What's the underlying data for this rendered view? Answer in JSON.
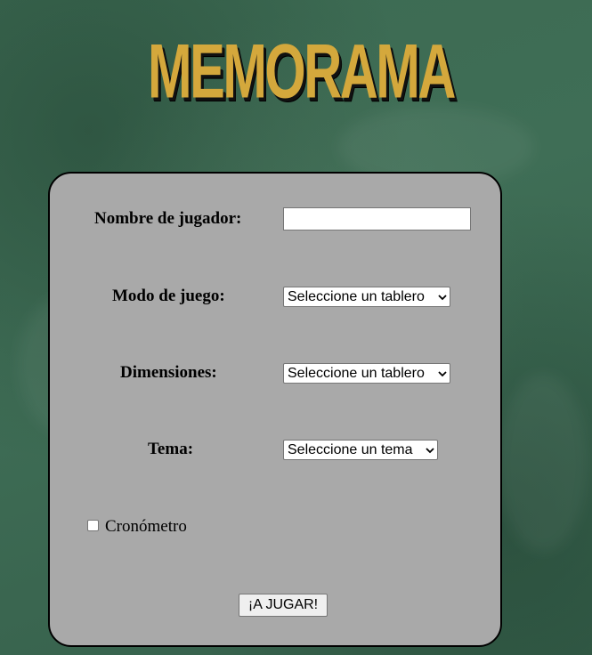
{
  "app": {
    "title": "MEMORAMA"
  },
  "form": {
    "player_name": {
      "label": "Nombre de jugador:",
      "value": ""
    },
    "game_mode": {
      "label": "Modo de juego:",
      "selected": "Seleccione un tablero"
    },
    "dimensions": {
      "label": "Dimensiones:",
      "selected": "Seleccione un tablero"
    },
    "theme": {
      "label": "Tema:",
      "selected": "Seleccione un tema"
    },
    "timer": {
      "label": "Cronómetro",
      "checked": false
    },
    "play_button": {
      "label": "¡A JUGAR!"
    }
  },
  "colors": {
    "background": "#3f6e56",
    "title": "#d4a83c",
    "panel": "#a9a9a9"
  },
  "icons": {
    "select_arrow": "chevron-down-icon"
  }
}
